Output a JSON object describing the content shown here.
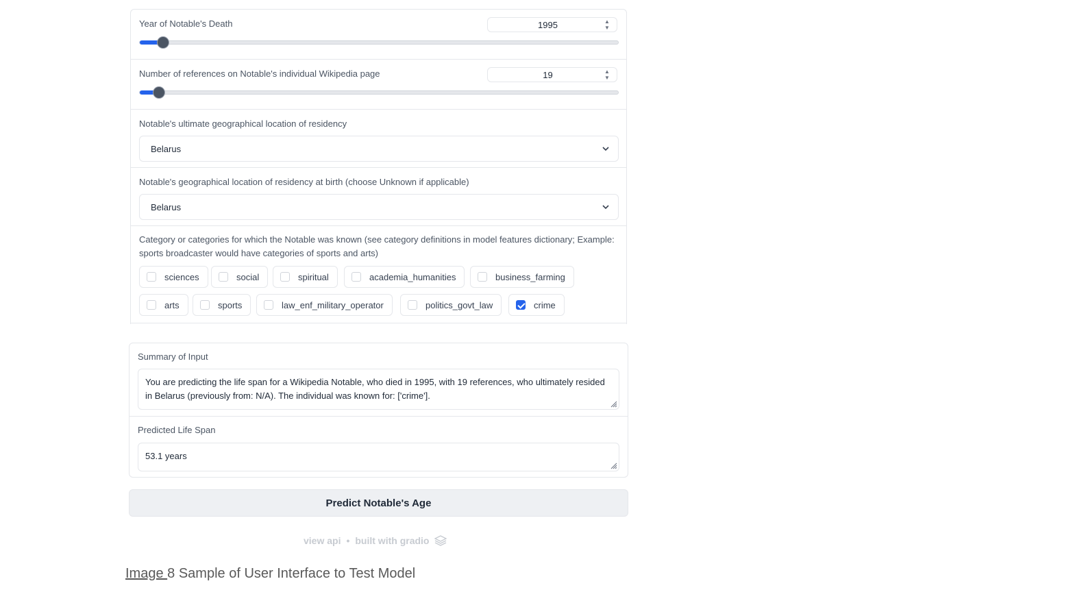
{
  "year_death": {
    "label": "Year of Notable's Death",
    "value": "1995",
    "fraction": 0.05
  },
  "references": {
    "label": "Number of references on Notable's individual Wikipedia page",
    "value": "19",
    "fraction": 0.04
  },
  "ultimate_location": {
    "label": "Notable's ultimate geographical location of residency",
    "value": "Belarus"
  },
  "birth_location": {
    "label": "Notable's geographical location of residency at birth (choose Unknown if applicable)",
    "value": "Belarus"
  },
  "categories": {
    "label": "Category or categories for which the Notable was known (see category definitions in model features dictionary; Example: sports broadcaster would have categories of sports and arts)",
    "options": [
      {
        "label": "sciences",
        "checked": false
      },
      {
        "label": "social",
        "checked": false
      },
      {
        "label": "spiritual",
        "checked": false
      },
      {
        "label": "academia_humanities",
        "checked": false
      },
      {
        "label": "business_farming",
        "checked": false
      },
      {
        "label": "arts",
        "checked": false
      },
      {
        "label": "sports",
        "checked": false
      },
      {
        "label": "law_enf_military_operator",
        "checked": false
      },
      {
        "label": "politics_govt_law",
        "checked": false
      },
      {
        "label": "crime",
        "checked": true
      }
    ]
  },
  "summary": {
    "label": "Summary of Input",
    "value": "You are predicting the life span for a Wikipedia Notable, who died in 1995, with 19 references, who ultimately resided in Belarus (previously from: N/A).  The individual was known for: ['crime']."
  },
  "prediction": {
    "label": "Predicted Life Span",
    "value": "53.1 years"
  },
  "predict_button": "Predict Notable's Age",
  "footer": {
    "view_api": "view api",
    "separator": "•",
    "built_with": "built with gradio"
  },
  "caption": {
    "prefix": "Image ",
    "number": "8",
    "text": " Sample of User Interface to Test Model"
  },
  "colors": {
    "accent": "#2563eb",
    "border": "#e5e7eb"
  }
}
